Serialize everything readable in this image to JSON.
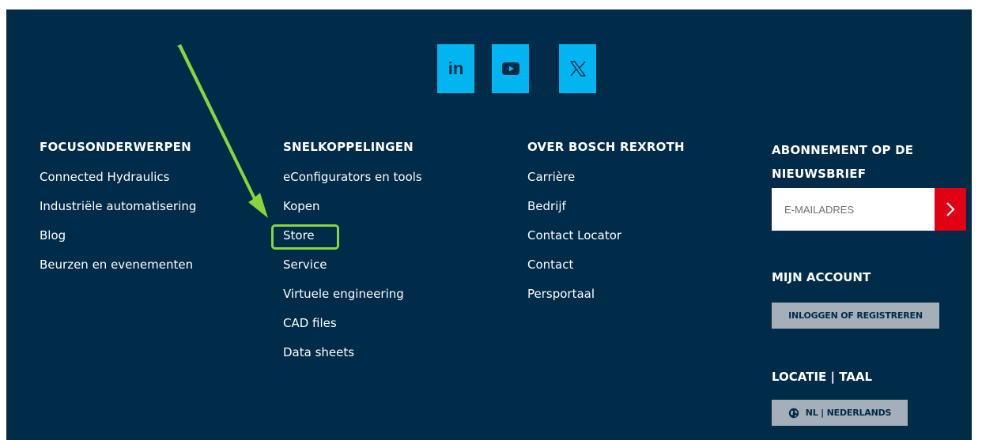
{
  "social": {
    "linkedin_label": "in",
    "youtube_icon": "youtube-icon",
    "x_icon": "x-icon",
    "color": "#00b5f0"
  },
  "columns": [
    {
      "heading": "FOCUSONDERWERPEN",
      "links": [
        "Connected Hydraulics",
        "Industriële automatisering",
        "Blog",
        "Beurzen en evenementen"
      ]
    },
    {
      "heading": "SNELKOPPELINGEN",
      "links": [
        "eConfigurators en tools",
        "Kopen",
        "Store",
        "Service",
        "Virtuele engineering",
        "CAD files",
        "Data sheets"
      ]
    },
    {
      "heading": "OVER BOSCH REXROTH",
      "links": [
        "Carrière",
        "Bedrijf",
        "Contact Locator",
        "Contact",
        "Persportaal"
      ]
    }
  ],
  "newsletter": {
    "heading_line1": "ABONNEMENT OP DE",
    "heading_line2": "NIEUWSBRIEF",
    "placeholder": "E-MAILADRES"
  },
  "account": {
    "heading": "MIJN ACCOUNT",
    "button_label": "INLOGGEN OF REGISTREREN"
  },
  "locale": {
    "heading": "LOCATIE | TAAL",
    "button_label": "NL | NEDERLANDS"
  },
  "colors": {
    "background": "#002b49",
    "accent": "#00b5f0",
    "submit": "#e20015",
    "highlight": "#8bd43c"
  }
}
